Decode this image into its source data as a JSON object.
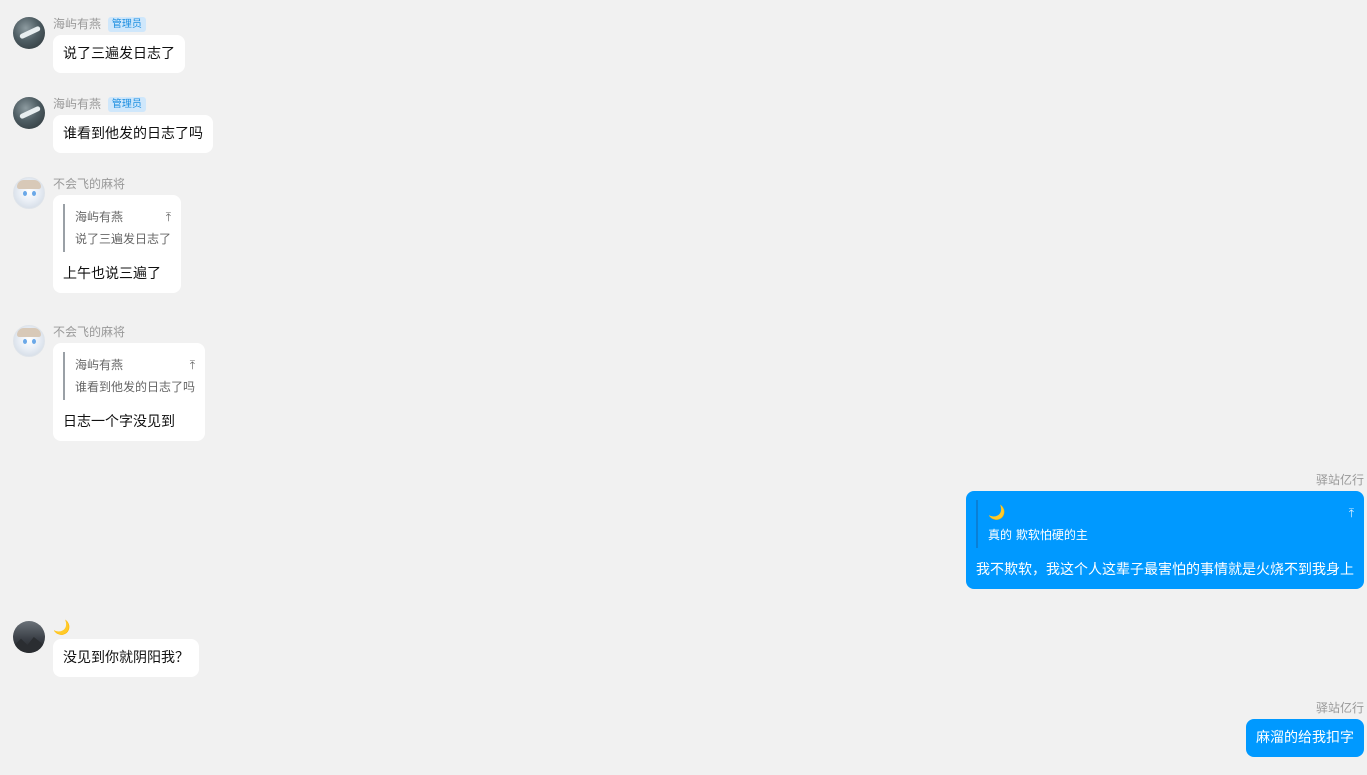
{
  "messages": [
    {
      "side": "left",
      "sender": "海屿有燕",
      "badge": "管理员",
      "text": "说了三遍发日志了"
    },
    {
      "side": "left",
      "sender": "海屿有燕",
      "badge": "管理员",
      "text": "谁看到他发的日志了吗"
    },
    {
      "side": "left",
      "sender": "不会飞的麻将",
      "quote": {
        "author": "海屿有燕",
        "text": "说了三遍发日志了",
        "arrow": "⤒"
      },
      "text": "上午也说三遍了"
    },
    {
      "side": "left",
      "sender": "不会飞的麻将",
      "quote": {
        "author": "海屿有燕",
        "text": "谁看到他发的日志了吗",
        "arrow": "⤒"
      },
      "text": "日志一个字没见到"
    },
    {
      "side": "right",
      "sender": "驿站亿行",
      "quote": {
        "author": "🌙",
        "text": "真的 欺软怕硬的主",
        "arrow": "⤒"
      },
      "text": "我不欺软，我这个人这辈子最害怕的事情就是火烧不到我身上"
    },
    {
      "side": "left",
      "sender": "🌙",
      "text": "没见到你就阴阳我？"
    },
    {
      "side": "right",
      "sender": "驿站亿行",
      "text": "麻溜的给我扣字"
    }
  ],
  "colors": {
    "background": "#f1f1f1",
    "own_bubble": "#0099ff",
    "other_bubble": "#ffffff",
    "admin_badge_bg": "#cfe7fb",
    "admin_badge_text": "#1d8fe0"
  }
}
